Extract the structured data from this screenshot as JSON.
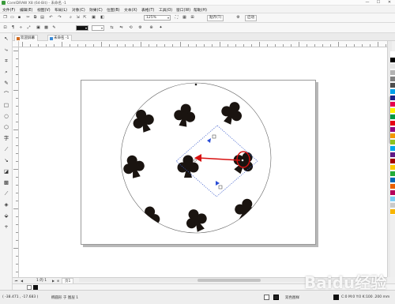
{
  "window": {
    "title": "CorelDRAW X8 (64-Bit) - 未命名 -1",
    "minimize": "—",
    "maximize": "☐",
    "close": "✕"
  },
  "menu": [
    "文件(F)",
    "编辑(E)",
    "视图(V)",
    "布局(L)",
    "对象(C)",
    "效果(C)",
    "位图(B)",
    "文本(X)",
    "表格(T)",
    "工具(O)",
    "窗口(W)",
    "帮助(H)"
  ],
  "toolbar": {
    "zoom_value": "125%",
    "snap_label": "贴齐(T)",
    "launch_label": "启动"
  },
  "propbar": {
    "fill_value": "",
    "outline_value": ""
  },
  "tabs": {
    "welcome": "欢迎屏幕",
    "document": "未命名 -1"
  },
  "pagenav": {
    "count": "1 的 1",
    "page_tab": "页1"
  },
  "status": {
    "coords": "( -38.471 , -17.683 )",
    "object_info": "椭圆形 于 图层 1",
    "fill_label": "双色图样",
    "outline_label": "C:0 M:0 Y:0 K:100  .200 mm"
  },
  "palette_colors": [
    "#ffffff",
    "#000000",
    "#e6e6e6",
    "#b3b3b3",
    "#808080",
    "#4d4d4d",
    "#00a0e9",
    "#1d2088",
    "#e5004f",
    "#fff100",
    "#009944",
    "#e60012",
    "#920783",
    "#f39800",
    "#8fc31f",
    "#00a7ea",
    "#601986",
    "#a40000",
    "#fcc800",
    "#22ac38",
    "#0068b7",
    "#eb6100",
    "#b5005b",
    "#7ecef4",
    "#c9caca",
    "#f8b500"
  ],
  "watermark": "Baidu经验"
}
